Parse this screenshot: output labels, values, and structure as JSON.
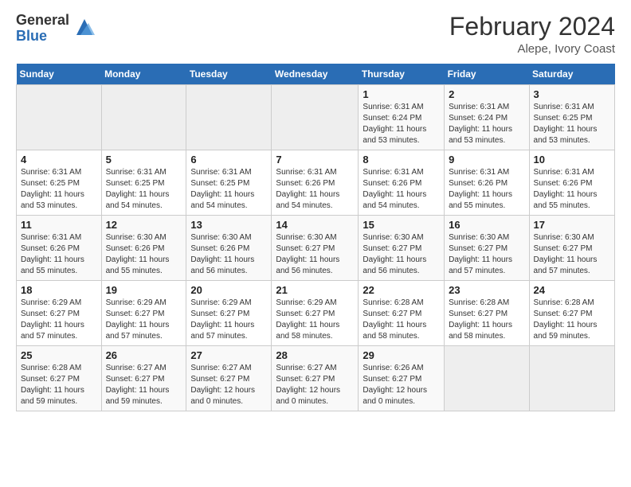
{
  "header": {
    "logo_general": "General",
    "logo_blue": "Blue",
    "main_title": "February 2024",
    "sub_title": "Alepe, Ivory Coast"
  },
  "days_of_week": [
    "Sunday",
    "Monday",
    "Tuesday",
    "Wednesday",
    "Thursday",
    "Friday",
    "Saturday"
  ],
  "weeks": [
    [
      {
        "day": "",
        "info": ""
      },
      {
        "day": "",
        "info": ""
      },
      {
        "day": "",
        "info": ""
      },
      {
        "day": "",
        "info": ""
      },
      {
        "day": "1",
        "info": "Sunrise: 6:31 AM\nSunset: 6:24 PM\nDaylight: 11 hours and 53 minutes."
      },
      {
        "day": "2",
        "info": "Sunrise: 6:31 AM\nSunset: 6:24 PM\nDaylight: 11 hours and 53 minutes."
      },
      {
        "day": "3",
        "info": "Sunrise: 6:31 AM\nSunset: 6:25 PM\nDaylight: 11 hours and 53 minutes."
      }
    ],
    [
      {
        "day": "4",
        "info": "Sunrise: 6:31 AM\nSunset: 6:25 PM\nDaylight: 11 hours and 53 minutes."
      },
      {
        "day": "5",
        "info": "Sunrise: 6:31 AM\nSunset: 6:25 PM\nDaylight: 11 hours and 54 minutes."
      },
      {
        "day": "6",
        "info": "Sunrise: 6:31 AM\nSunset: 6:25 PM\nDaylight: 11 hours and 54 minutes."
      },
      {
        "day": "7",
        "info": "Sunrise: 6:31 AM\nSunset: 6:26 PM\nDaylight: 11 hours and 54 minutes."
      },
      {
        "day": "8",
        "info": "Sunrise: 6:31 AM\nSunset: 6:26 PM\nDaylight: 11 hours and 54 minutes."
      },
      {
        "day": "9",
        "info": "Sunrise: 6:31 AM\nSunset: 6:26 PM\nDaylight: 11 hours and 55 minutes."
      },
      {
        "day": "10",
        "info": "Sunrise: 6:31 AM\nSunset: 6:26 PM\nDaylight: 11 hours and 55 minutes."
      }
    ],
    [
      {
        "day": "11",
        "info": "Sunrise: 6:31 AM\nSunset: 6:26 PM\nDaylight: 11 hours and 55 minutes."
      },
      {
        "day": "12",
        "info": "Sunrise: 6:30 AM\nSunset: 6:26 PM\nDaylight: 11 hours and 55 minutes."
      },
      {
        "day": "13",
        "info": "Sunrise: 6:30 AM\nSunset: 6:26 PM\nDaylight: 11 hours and 56 minutes."
      },
      {
        "day": "14",
        "info": "Sunrise: 6:30 AM\nSunset: 6:27 PM\nDaylight: 11 hours and 56 minutes."
      },
      {
        "day": "15",
        "info": "Sunrise: 6:30 AM\nSunset: 6:27 PM\nDaylight: 11 hours and 56 minutes."
      },
      {
        "day": "16",
        "info": "Sunrise: 6:30 AM\nSunset: 6:27 PM\nDaylight: 11 hours and 57 minutes."
      },
      {
        "day": "17",
        "info": "Sunrise: 6:30 AM\nSunset: 6:27 PM\nDaylight: 11 hours and 57 minutes."
      }
    ],
    [
      {
        "day": "18",
        "info": "Sunrise: 6:29 AM\nSunset: 6:27 PM\nDaylight: 11 hours and 57 minutes."
      },
      {
        "day": "19",
        "info": "Sunrise: 6:29 AM\nSunset: 6:27 PM\nDaylight: 11 hours and 57 minutes."
      },
      {
        "day": "20",
        "info": "Sunrise: 6:29 AM\nSunset: 6:27 PM\nDaylight: 11 hours and 57 minutes."
      },
      {
        "day": "21",
        "info": "Sunrise: 6:29 AM\nSunset: 6:27 PM\nDaylight: 11 hours and 58 minutes."
      },
      {
        "day": "22",
        "info": "Sunrise: 6:28 AM\nSunset: 6:27 PM\nDaylight: 11 hours and 58 minutes."
      },
      {
        "day": "23",
        "info": "Sunrise: 6:28 AM\nSunset: 6:27 PM\nDaylight: 11 hours and 58 minutes."
      },
      {
        "day": "24",
        "info": "Sunrise: 6:28 AM\nSunset: 6:27 PM\nDaylight: 11 hours and 59 minutes."
      }
    ],
    [
      {
        "day": "25",
        "info": "Sunrise: 6:28 AM\nSunset: 6:27 PM\nDaylight: 11 hours and 59 minutes."
      },
      {
        "day": "26",
        "info": "Sunrise: 6:27 AM\nSunset: 6:27 PM\nDaylight: 11 hours and 59 minutes."
      },
      {
        "day": "27",
        "info": "Sunrise: 6:27 AM\nSunset: 6:27 PM\nDaylight: 12 hours and 0 minutes."
      },
      {
        "day": "28",
        "info": "Sunrise: 6:27 AM\nSunset: 6:27 PM\nDaylight: 12 hours and 0 minutes."
      },
      {
        "day": "29",
        "info": "Sunrise: 6:26 AM\nSunset: 6:27 PM\nDaylight: 12 hours and 0 minutes."
      },
      {
        "day": "",
        "info": ""
      },
      {
        "day": "",
        "info": ""
      }
    ]
  ]
}
